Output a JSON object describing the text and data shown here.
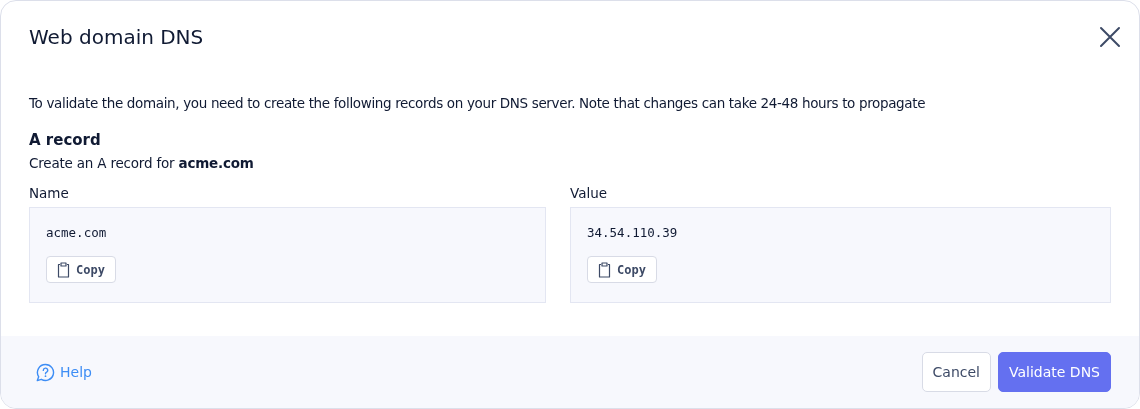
{
  "dialog": {
    "title": "Web domain DNS"
  },
  "description": "To validate the domain, you need to create the following records on your DNS server. Note that changes can take 24-48 hours to propagate",
  "record": {
    "heading": "A record",
    "subtitle": "Create an A record for **acme.com**"
  },
  "fields": [
    {
      "label": "Name",
      "value": "acme.com",
      "copy": "Copy"
    },
    {
      "label": "Value",
      "value": "34.54.110.39",
      "copy": "Copy"
    }
  ],
  "footer": {
    "help": "Help",
    "buttons": [
      {
        "label": "Cancel",
        "kind": "secondary"
      },
      {
        "label": "Validate DNS",
        "kind": "primary"
      }
    ]
  }
}
